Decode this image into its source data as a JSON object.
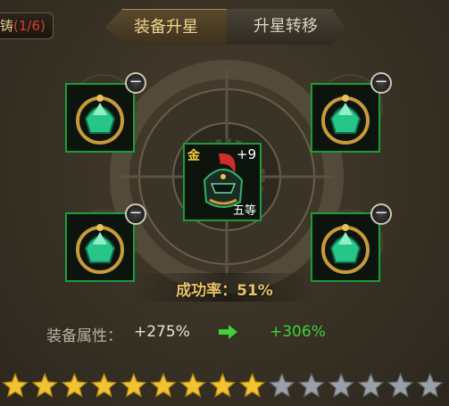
{
  "header": {
    "forge_label_tail": "铸",
    "forge_count": "(1/6)",
    "tabs": [
      {
        "label": "装备升星",
        "active": true
      },
      {
        "label": "升星转移",
        "active": false
      }
    ]
  },
  "slots": {
    "remove_glyph": "−",
    "material_icon": "green-helmet-gem-icon"
  },
  "center_item": {
    "quality": "金",
    "level": "+9",
    "grade": "五等",
    "icon": "red-plume-helmet-icon"
  },
  "success": {
    "text": "成功率：51%"
  },
  "attributes": {
    "label": "装备属性：",
    "from": "+275%",
    "to": "+306%",
    "arrow_icon": "green-right-arrow-icon"
  },
  "stars": {
    "filled": 9,
    "total": 15,
    "filled_color": "#f2c233",
    "empty_color": "#9aa0a8"
  },
  "colors": {
    "slot_border": "#1a9d3a",
    "tab_active_text": "#f0d48a",
    "gain": "#3dd13a"
  }
}
